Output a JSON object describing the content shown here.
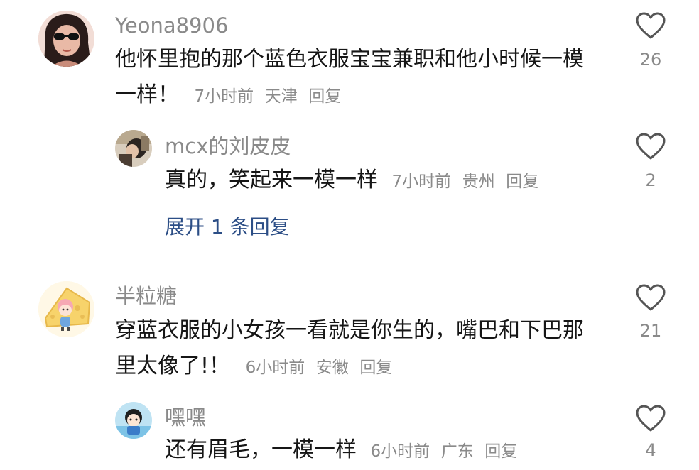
{
  "comments": [
    {
      "username": "Yeona8906",
      "text_line1": "他怀里抱的那个蓝色衣服宝宝兼职和他小时候一模",
      "text_line2": "一样！",
      "time": "7小时前",
      "location": "天津",
      "reply_label": "回复",
      "likes": "26",
      "replies": [
        {
          "username": "mcx的刘皮皮",
          "text": "真的，笑起来一模一样",
          "time": "7小时前",
          "location": "贵州",
          "reply_label": "回复",
          "likes": "2"
        }
      ],
      "expand_label": "展开 1 条回复"
    },
    {
      "username": "半粒糖",
      "text_line1": "穿蓝衣服的小女孩一看就是你生的，嘴巴和下巴那",
      "text_line2": "里太像了!！",
      "time": "6小时前",
      "location": "安徽",
      "reply_label": "回复",
      "likes": "21",
      "replies": [
        {
          "username": "嘿嘿",
          "text": "还有眉毛，一模一样",
          "time": "6小时前",
          "location": "广东",
          "reply_label": "回复",
          "likes": "4"
        }
      ]
    }
  ]
}
